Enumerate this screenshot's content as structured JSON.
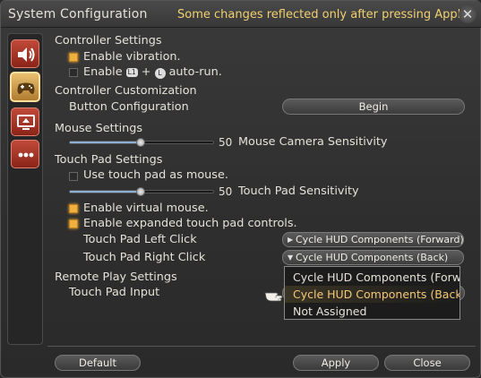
{
  "window": {
    "title": "System Configuration",
    "notice": "Some changes reflected only after pressing Apply.",
    "close_icon": "close-x-icon"
  },
  "sidebar": {
    "tabs": [
      {
        "name": "sound",
        "icon": "speaker-icon",
        "active": false
      },
      {
        "name": "controller",
        "icon": "gamepad-icon",
        "active": true
      },
      {
        "name": "display",
        "icon": "monitor-icon",
        "active": false
      },
      {
        "name": "other",
        "icon": "more-dots-icon",
        "active": false
      }
    ]
  },
  "controller_settings": {
    "heading": "Controller Settings",
    "enable_vibration": {
      "label": "Enable vibration.",
      "checked": true
    },
    "auto_run": {
      "label_prefix": "Enable",
      "button_l1": "L1",
      "plus": "+",
      "button_l": "L",
      "label_suffix": "auto-run.",
      "checked": false
    }
  },
  "controller_customization": {
    "heading": "Controller Customization",
    "button_config_label": "Button Configuration",
    "begin_button": "Begin"
  },
  "mouse_settings": {
    "heading": "Mouse Settings",
    "camera_sensitivity": {
      "value": "50",
      "label": "Mouse Camera Sensitivity",
      "level": 0.5
    }
  },
  "touch_pad_settings": {
    "heading": "Touch Pad Settings",
    "use_touch_pad_as_mouse": {
      "label": "Use touch pad as mouse.",
      "checked": false
    },
    "sensitivity": {
      "value": "50",
      "label": "Touch Pad Sensitivity",
      "level": 0.5
    },
    "enable_virtual_mouse": {
      "label": "Enable virtual mouse.",
      "checked": true
    },
    "enable_expanded_controls": {
      "label": "Enable expanded touch pad controls.",
      "checked": true
    },
    "left_click": {
      "label": "Touch Pad Left Click",
      "value": "Cycle HUD Components (Forward)"
    },
    "right_click": {
      "label": "Touch Pad Right Click",
      "value": "Cycle HUD Components (Back)"
    }
  },
  "remote_play_settings": {
    "heading": "Remote Play Settings",
    "touch_pad_input_label": "Touch Pad Input"
  },
  "dropdown_popup": {
    "options": [
      {
        "label": "Cycle HUD Components (Forward)",
        "selected": false
      },
      {
        "label": "Cycle HUD Components (Back)",
        "selected": true
      },
      {
        "label": "Not Assigned",
        "selected": false
      }
    ]
  },
  "footer": {
    "default_button": "Default",
    "apply_button": "Apply",
    "close_button": "Close"
  },
  "colors": {
    "notice": "#f0d070",
    "checkbox_on": "#f0b040",
    "selected_option": "#f4c878"
  }
}
